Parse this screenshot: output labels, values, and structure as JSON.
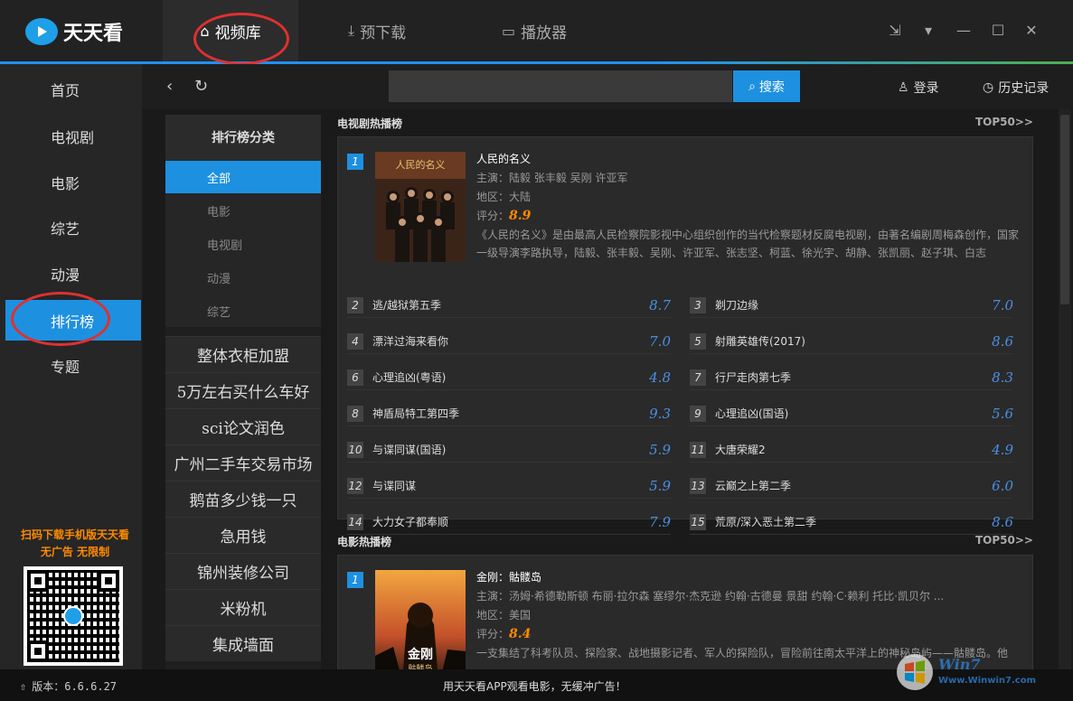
{
  "app": {
    "name": "天天看"
  },
  "main_tabs": [
    {
      "label": "视频库",
      "active": true
    },
    {
      "label": "预下载",
      "active": false
    },
    {
      "label": "播放器",
      "active": false
    }
  ],
  "left_nav": [
    {
      "label": "首页"
    },
    {
      "label": "电视剧"
    },
    {
      "label": "电影"
    },
    {
      "label": "综艺"
    },
    {
      "label": "动漫"
    },
    {
      "label": "排行榜",
      "active": true
    },
    {
      "label": "专题"
    }
  ],
  "promo": {
    "line1": "扫码下载手机版天天看",
    "line2": "无广告  无限制"
  },
  "search": {
    "placeholder": "",
    "button_label": "搜索"
  },
  "toolbar": {
    "login_label": "登录",
    "history_label": "历史记录"
  },
  "categories": {
    "heading": "排行榜分类",
    "items": [
      "全部",
      "电影",
      "电视剧",
      "动漫",
      "综艺"
    ],
    "ads": [
      "整体衣柜加盟",
      "5万左右买什么车好",
      "sci论文润色",
      "广州二手车交易市场",
      "鹅苗多少钱一只",
      "急用钱",
      "锦州装修公司",
      "米粉机",
      "集成墙面"
    ]
  },
  "tv_section": {
    "title": "电视剧热播榜",
    "more": "TOP50>>",
    "featured": {
      "rank": "1",
      "title": "人民的名义",
      "cast": "主演：陆毅 张丰毅 吴刚 许亚军",
      "region": "地区：大陆",
      "score_label": "评分：",
      "score": "8.9",
      "description": "《人民的名义》是由最高人民检察院影视中心组织创作的当代检察题材反腐电视剧，由著名编剧周梅森创作，国家一级导演李路执导，陆毅、张丰毅、吴刚、许亚军、张志坚、柯蓝、徐光宇、胡静、张凯丽、赵子琪、白志"
    },
    "list": [
      {
        "rank": "2",
        "title": "逃/越狱第五季",
        "score": "8.7"
      },
      {
        "rank": "3",
        "title": "剃刀边缘",
        "score": "7.0"
      },
      {
        "rank": "4",
        "title": "漂洋过海来看你",
        "score": "7.0"
      },
      {
        "rank": "5",
        "title": "射雕英雄传(2017)",
        "score": "8.6"
      },
      {
        "rank": "6",
        "title": "心理追凶(粤语)",
        "score": "4.8"
      },
      {
        "rank": "7",
        "title": "行尸走肉第七季",
        "score": "8.3"
      },
      {
        "rank": "8",
        "title": "神盾局特工第四季",
        "score": "9.3"
      },
      {
        "rank": "9",
        "title": "心理追凶(国语)",
        "score": "5.6"
      },
      {
        "rank": "10",
        "title": "与谍同谋(国语)",
        "score": "5.9"
      },
      {
        "rank": "11",
        "title": "大唐荣耀2",
        "score": "4.9"
      },
      {
        "rank": "12",
        "title": "与谍同谋",
        "score": "5.9"
      },
      {
        "rank": "13",
        "title": "云巅之上第二季",
        "score": "6.0"
      },
      {
        "rank": "14",
        "title": "大力女子都奉顺",
        "score": "7.9"
      },
      {
        "rank": "15",
        "title": "荒原/深入恶土第二季",
        "score": "8.6"
      }
    ]
  },
  "movie_section": {
    "title": "电影热播榜",
    "more": "TOP50>>",
    "featured": {
      "rank": "1",
      "title": "金刚：骷髅岛",
      "cast": "主演：汤姆·希德勒斯顿 布丽·拉尔森 塞缪尔·杰克逊 约翰·古德曼 景甜 约翰·C·赖利 托比·凯贝尔 ...",
      "region": "地区：美国",
      "score_label": "评分：",
      "score": "8.4",
      "description": "一支集结了科考队员、探险家、战地摄影记者、军人的探险队，冒险前往南太平洋上的神秘岛屿——骷髅岛。他"
    }
  },
  "statusbar": {
    "version": "版本：6.6.6.27",
    "message": "用天天看APP观看电影，无缓冲广告！"
  },
  "watermark": {
    "text": "Win7",
    "url": "Www.Winwin7.com"
  },
  "colors": {
    "accent": "#1e90e0",
    "score_featured": "#ff8a00",
    "score_list": "#4a90e2",
    "highlight_circle": "#e03030"
  }
}
